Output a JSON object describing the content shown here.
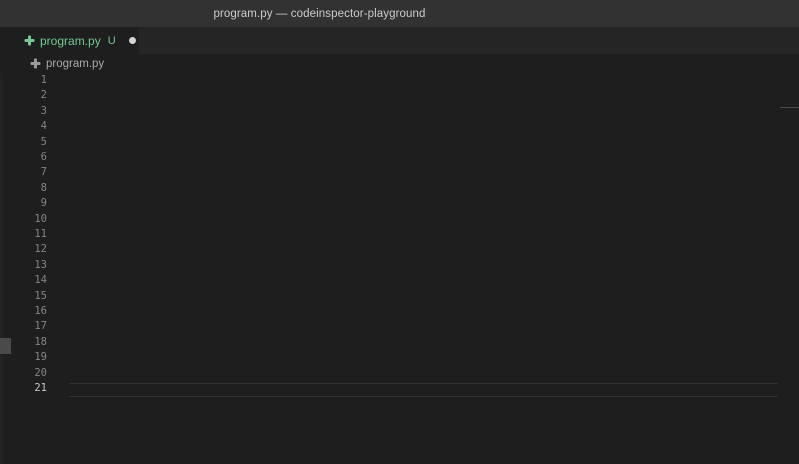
{
  "window": {
    "title": "program.py — codeinspector-playground"
  },
  "tab": {
    "label": "program.py",
    "status": "U",
    "icon": "python-file-icon",
    "modified": true
  },
  "breadcrumb": {
    "file": "program.py",
    "icon": "python-file-icon"
  },
  "editor": {
    "line_numbers": [
      "1",
      "2",
      "3",
      "4",
      "5",
      "6",
      "7",
      "8",
      "9",
      "10",
      "11",
      "12",
      "13",
      "14",
      "15",
      "16",
      "17",
      "18",
      "19",
      "20",
      "21"
    ],
    "active_line": 21
  },
  "colors": {
    "untracked": "#73c991",
    "editor_bg": "#1e1e1e",
    "titlebar_bg": "#323233",
    "tabbar_bg": "#252526"
  }
}
